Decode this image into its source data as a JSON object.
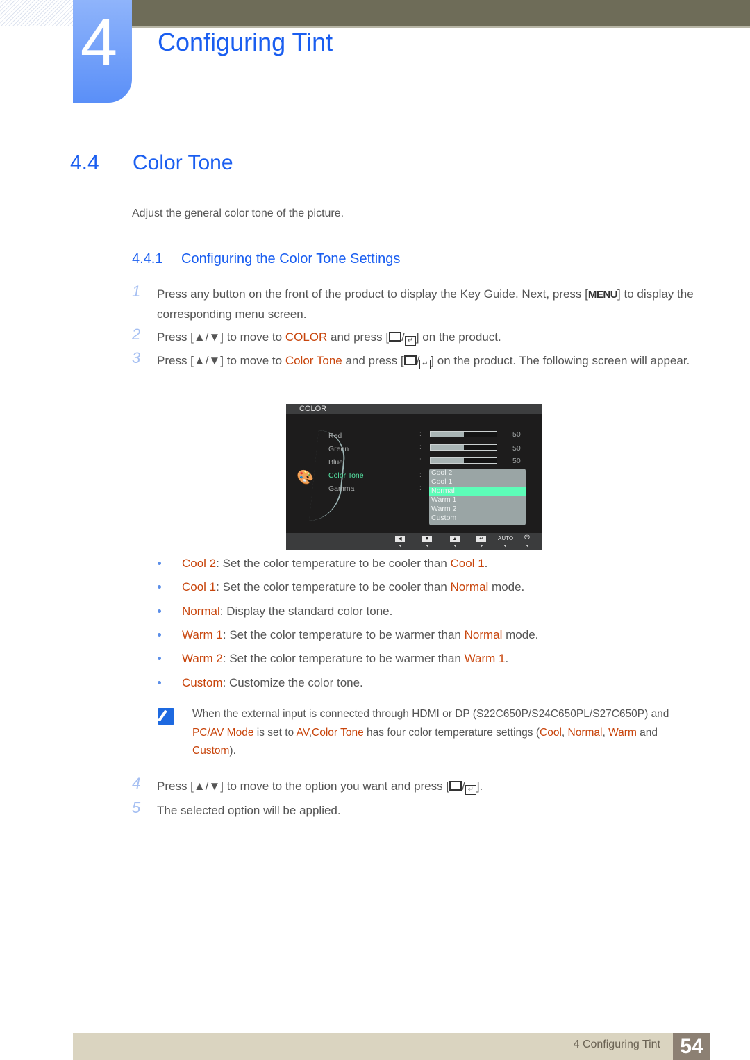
{
  "chapter": {
    "number": "4",
    "title": "Configuring Tint"
  },
  "section": {
    "number": "4.4",
    "title": "Color Tone",
    "intro": "Adjust the general color tone of the picture."
  },
  "subsection": {
    "number": "4.4.1",
    "title": "Configuring the Color Tone Settings"
  },
  "steps": [
    {
      "n": "1",
      "a": "Press any button on the front of the product to display the Key Guide. Next, press [",
      "key": "MENU",
      "b": "] to display the corresponding menu screen."
    },
    {
      "n": "2",
      "a": "Press [▲/▼] to move to ",
      "hl": "COLOR",
      "b": " and press [",
      "c": "] on the product."
    },
    {
      "n": "3",
      "a": "Press [▲/▼] to move to ",
      "hl": "Color Tone",
      "b": " and press [",
      "c": "] on the product. The following screen will appear."
    },
    {
      "n": "4",
      "a": "Press [▲/▼] to move to the option you want and press [",
      "c": "]."
    },
    {
      "n": "5",
      "a": "The selected option will be applied."
    }
  ],
  "osd": {
    "header": "COLOR",
    "items": [
      {
        "label": "Red",
        "value": "50",
        "level": 0.5
      },
      {
        "label": "Green",
        "value": "50",
        "level": 0.5
      },
      {
        "label": "Blue",
        "value": "50",
        "level": 0.5
      },
      {
        "label": "Color Tone"
      },
      {
        "label": "Gamma"
      }
    ],
    "options": [
      "Cool 2",
      "Cool 1",
      "Normal",
      "Warm 1",
      "Warm 2",
      "Custom"
    ],
    "selected_option": "Normal",
    "footer_auto": "AUTO",
    "colors": {
      "selected": "#55e2a2",
      "highlight": "#5dfdb8"
    }
  },
  "bullets": [
    {
      "term": "Cool 2",
      "text": ": Set the color temperature to be cooler than ",
      "ref": "Cool 1",
      "end": "."
    },
    {
      "term": "Cool 1",
      "text": ": Set the color temperature to be cooler than ",
      "ref": "Normal",
      "end": " mode."
    },
    {
      "term": "Normal",
      "text": ": Display the standard color tone.",
      "ref": "",
      "end": ""
    },
    {
      "term": "Warm 1",
      "text": ": Set the color temperature to be warmer than ",
      "ref": "Normal",
      "end": " mode."
    },
    {
      "term": "Warm 2",
      "text": ": Set the color temperature to be warmer than ",
      "ref": "Warm 1",
      "end": "."
    },
    {
      "term": "Custom",
      "text": ": Customize the color tone.",
      "ref": "",
      "end": ""
    }
  ],
  "note": {
    "p1": "When the external input is connected through HDMI or DP (S22C650P/S24C650PL/S27C650P) and ",
    "link": "PC/AV Mode",
    "p2": " is set to ",
    "av": "AV",
    "p3": ",",
    "ct": "Color Tone",
    "p4": " has four color temperature settings (",
    "cool": "Cool",
    "c1": ", ",
    "normal": "Normal",
    "c2": ", ",
    "warm": "Warm",
    "and": " and ",
    "custom": "Custom",
    "end": ")."
  },
  "footer": {
    "text": "4 Configuring Tint",
    "page": "54"
  },
  "colors": {
    "heading": "#1a5ef0",
    "highlight": "#c8450c",
    "body": "#555555"
  }
}
